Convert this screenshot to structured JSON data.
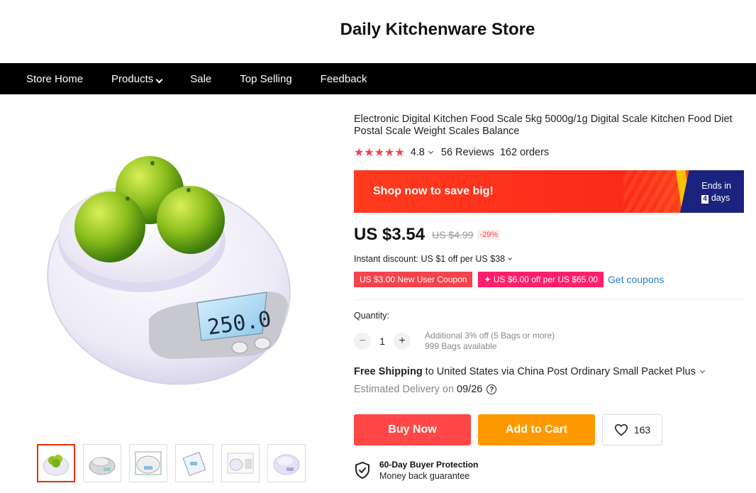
{
  "store": {
    "title": "Daily Kitchenware Store"
  },
  "nav": {
    "items": [
      {
        "label": "Store Home"
      },
      {
        "label": "Products"
      },
      {
        "label": "Sale"
      },
      {
        "label": "Top Selling"
      },
      {
        "label": "Feedback"
      }
    ]
  },
  "product": {
    "title": "Electronic Digital Kitchen Food Scale 5kg 5000g/1g Digital Scale Kitchen Food Diet Postal Scale Weight Scales Balance",
    "rating": "4.8",
    "star_count": 5,
    "reviews": "56 Reviews",
    "orders": "162 orders",
    "scale_display": "250.0"
  },
  "promo": {
    "text": "Shop now to save big!",
    "ends_label": "Ends in",
    "ends_num": "4",
    "ends_unit": "days"
  },
  "price": {
    "current": "US $3.54",
    "original": "US $4.99",
    "discount": "-29%"
  },
  "instant_discount": "Instant discount: US $1 off per US $38",
  "coupons": {
    "new_user": "US $3.00 New User Coupon",
    "store": "US $6.00 off per US $65.00",
    "store_icon": "✦",
    "get_label": "Get coupons"
  },
  "quantity": {
    "label": "Quantity:",
    "minus": "−",
    "plus": "+",
    "value": "1",
    "note_line1": "Additional 3% off (5 Bags or more)",
    "note_line2": "999 Bags available"
  },
  "shipping": {
    "free": "Free Shipping",
    "via": "to United States via China Post Ordinary Small Packet Plus",
    "delivery_label": "Estimated Delivery on",
    "delivery_date": "09/26",
    "help_icon": "?"
  },
  "actions": {
    "buy_now": "Buy Now",
    "add_to_cart": "Add to Cart",
    "wishlist_count": "163"
  },
  "protection": {
    "title": "60-Day Buyer Protection",
    "subtitle": "Money back guarantee"
  },
  "thumbnails": [
    "main",
    "scale-silver",
    "scale-box",
    "scale-box-2",
    "scale-small",
    "scale-purple"
  ],
  "colors": {
    "accent": "#ff4747",
    "orange": "#ff9900",
    "navbar": "#000000",
    "link": "#2e7fc2"
  }
}
